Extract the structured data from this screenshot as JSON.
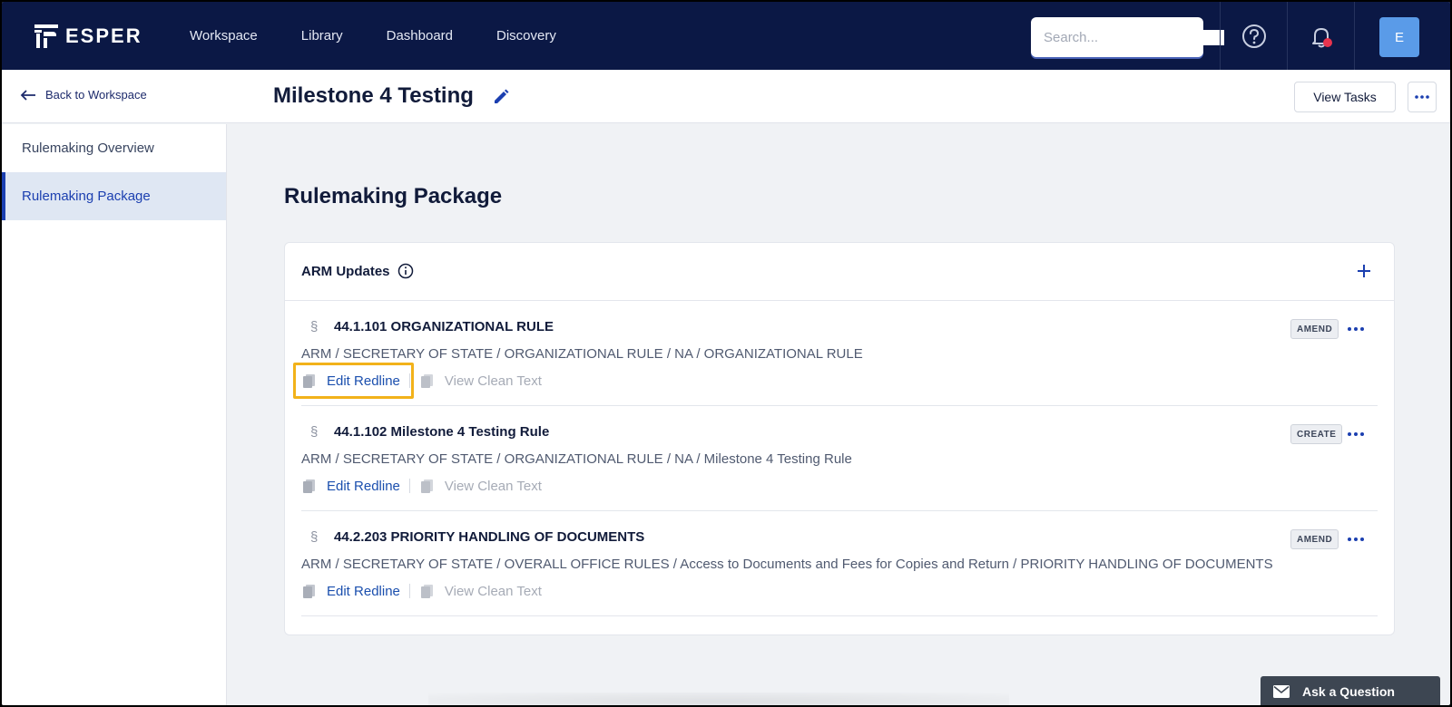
{
  "brand": {
    "name": "ESPER"
  },
  "nav": {
    "links": [
      "Workspace",
      "Library",
      "Dashboard",
      "Discovery"
    ],
    "search_placeholder": "Search...",
    "avatar_initial": "E"
  },
  "subheader": {
    "back_label": "Back to Workspace",
    "title": "Milestone 4 Testing",
    "view_tasks": "View Tasks"
  },
  "sidebar": {
    "items": [
      {
        "label": "Rulemaking Overview"
      },
      {
        "label": "Rulemaking Package"
      }
    ]
  },
  "main": {
    "section_title": "Rulemaking Package",
    "card_title": "ARM Updates",
    "rules": [
      {
        "section_symbol": "§",
        "title": "44.1.101 ORGANIZATIONAL RULE",
        "path": "ARM / SECRETARY OF STATE / ORGANIZATIONAL RULE / NA / ORGANIZATIONAL RULE",
        "edit_label": "Edit Redline",
        "view_label": "View Clean Text",
        "badge": "AMEND"
      },
      {
        "section_symbol": "§",
        "title": "44.1.102 Milestone 4 Testing Rule",
        "path": "ARM / SECRETARY OF STATE / ORGANIZATIONAL RULE / NA / Milestone 4 Testing Rule",
        "edit_label": "Edit Redline",
        "view_label": "View Clean Text",
        "badge": "CREATE"
      },
      {
        "section_symbol": "§",
        "title": "44.2.203 PRIORITY HANDLING OF DOCUMENTS",
        "path": "ARM / SECRETARY OF STATE / OVERALL OFFICE RULES / Access to Documents and Fees for Copies and Return / PRIORITY HANDLING OF DOCUMENTS",
        "edit_label": "Edit Redline",
        "view_label": "View Clean Text",
        "badge": "AMEND"
      }
    ]
  },
  "ask_question": "Ask a Question",
  "colors": {
    "nav_bg": "#0b1845",
    "accent": "#1b3fb0",
    "highlight": "#f2b21a",
    "notification_dot": "#e8344e"
  },
  "icons": {
    "search": "search-icon",
    "help": "help-icon",
    "bell": "bell-icon",
    "back": "arrow-left-icon",
    "edit": "pencil-icon",
    "more": "more-dots-icon",
    "info": "info-icon",
    "add": "plus-icon",
    "doc": "document-icon",
    "mail": "mail-icon"
  }
}
